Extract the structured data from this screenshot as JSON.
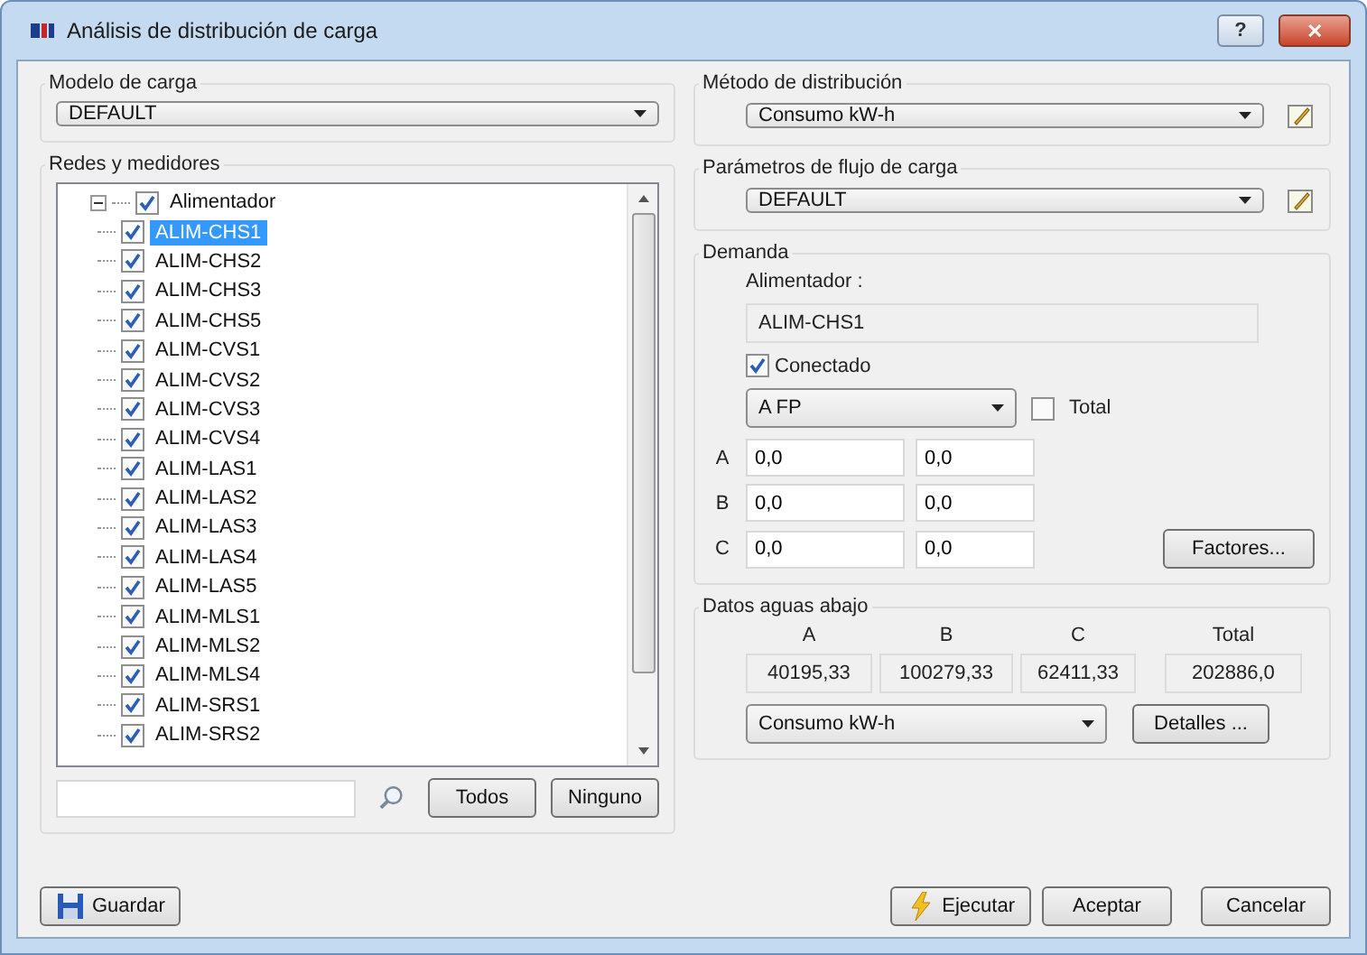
{
  "window": {
    "title": "Análisis de distribución de carga",
    "help": "?",
    "close": "✕"
  },
  "load_model": {
    "legend": "Modelo de carga",
    "value": "DEFAULT"
  },
  "networks": {
    "legend": "Redes y medidores",
    "tree": {
      "label": "Alimentador",
      "checked": true,
      "expanded": true,
      "selected": false,
      "children": [
        {
          "label": "ALIM-CHS1",
          "checked": true,
          "selected": true
        },
        {
          "label": "ALIM-CHS2",
          "checked": true,
          "selected": false
        },
        {
          "label": "ALIM-CHS3",
          "checked": true,
          "selected": false
        },
        {
          "label": "ALIM-CHS5",
          "checked": true,
          "selected": false
        },
        {
          "label": "ALIM-CVS1",
          "checked": true,
          "selected": false
        },
        {
          "label": "ALIM-CVS2",
          "checked": true,
          "selected": false
        },
        {
          "label": "ALIM-CVS3",
          "checked": true,
          "selected": false
        },
        {
          "label": "ALIM-CVS4",
          "checked": true,
          "selected": false
        },
        {
          "label": "ALIM-LAS1",
          "checked": true,
          "selected": false
        },
        {
          "label": "ALIM-LAS2",
          "checked": true,
          "selected": false
        },
        {
          "label": "ALIM-LAS3",
          "checked": true,
          "selected": false
        },
        {
          "label": "ALIM-LAS4",
          "checked": true,
          "selected": false
        },
        {
          "label": "ALIM-LAS5",
          "checked": true,
          "selected": false
        },
        {
          "label": "ALIM-MLS1",
          "checked": true,
          "selected": false
        },
        {
          "label": "ALIM-MLS2",
          "checked": true,
          "selected": false
        },
        {
          "label": "ALIM-MLS4",
          "checked": true,
          "selected": false
        },
        {
          "label": "ALIM-SRS1",
          "checked": true,
          "selected": false
        },
        {
          "label": "ALIM-SRS2",
          "checked": true,
          "selected": false
        }
      ]
    },
    "all_button": "Todos",
    "none_button": "Ninguno"
  },
  "method": {
    "legend": "Método de distribución",
    "value": "Consumo kW-h"
  },
  "flow_params": {
    "legend": "Parámetros de flujo de carga",
    "value": "DEFAULT"
  },
  "demand": {
    "legend": "Demanda",
    "feeder_label": "Alimentador :",
    "feeder_value": "ALIM-CHS1",
    "connected": {
      "label": "Conectado",
      "checked": true
    },
    "mode": "A FP",
    "total": {
      "label": "Total",
      "checked": false
    },
    "phases": [
      {
        "label": "A",
        "values": [
          "0,0",
          "0,0"
        ]
      },
      {
        "label": "B",
        "values": [
          "0,0",
          "0,0"
        ]
      },
      {
        "label": "C",
        "values": [
          "0,0",
          "0,0"
        ]
      }
    ],
    "factors_button": "Factores..."
  },
  "downstream": {
    "legend": "Datos aguas abajo",
    "columns": [
      "A",
      "B",
      "C",
      "Total"
    ],
    "values": [
      "40195,33",
      "100279,33",
      "62411,33",
      "202886,0"
    ],
    "unit": "Consumo kW-h",
    "details_button": "Detalles ..."
  },
  "buttons": {
    "save": "Guardar",
    "run": "Ejecutar",
    "accept": "Aceptar",
    "cancel": "Cancelar"
  }
}
